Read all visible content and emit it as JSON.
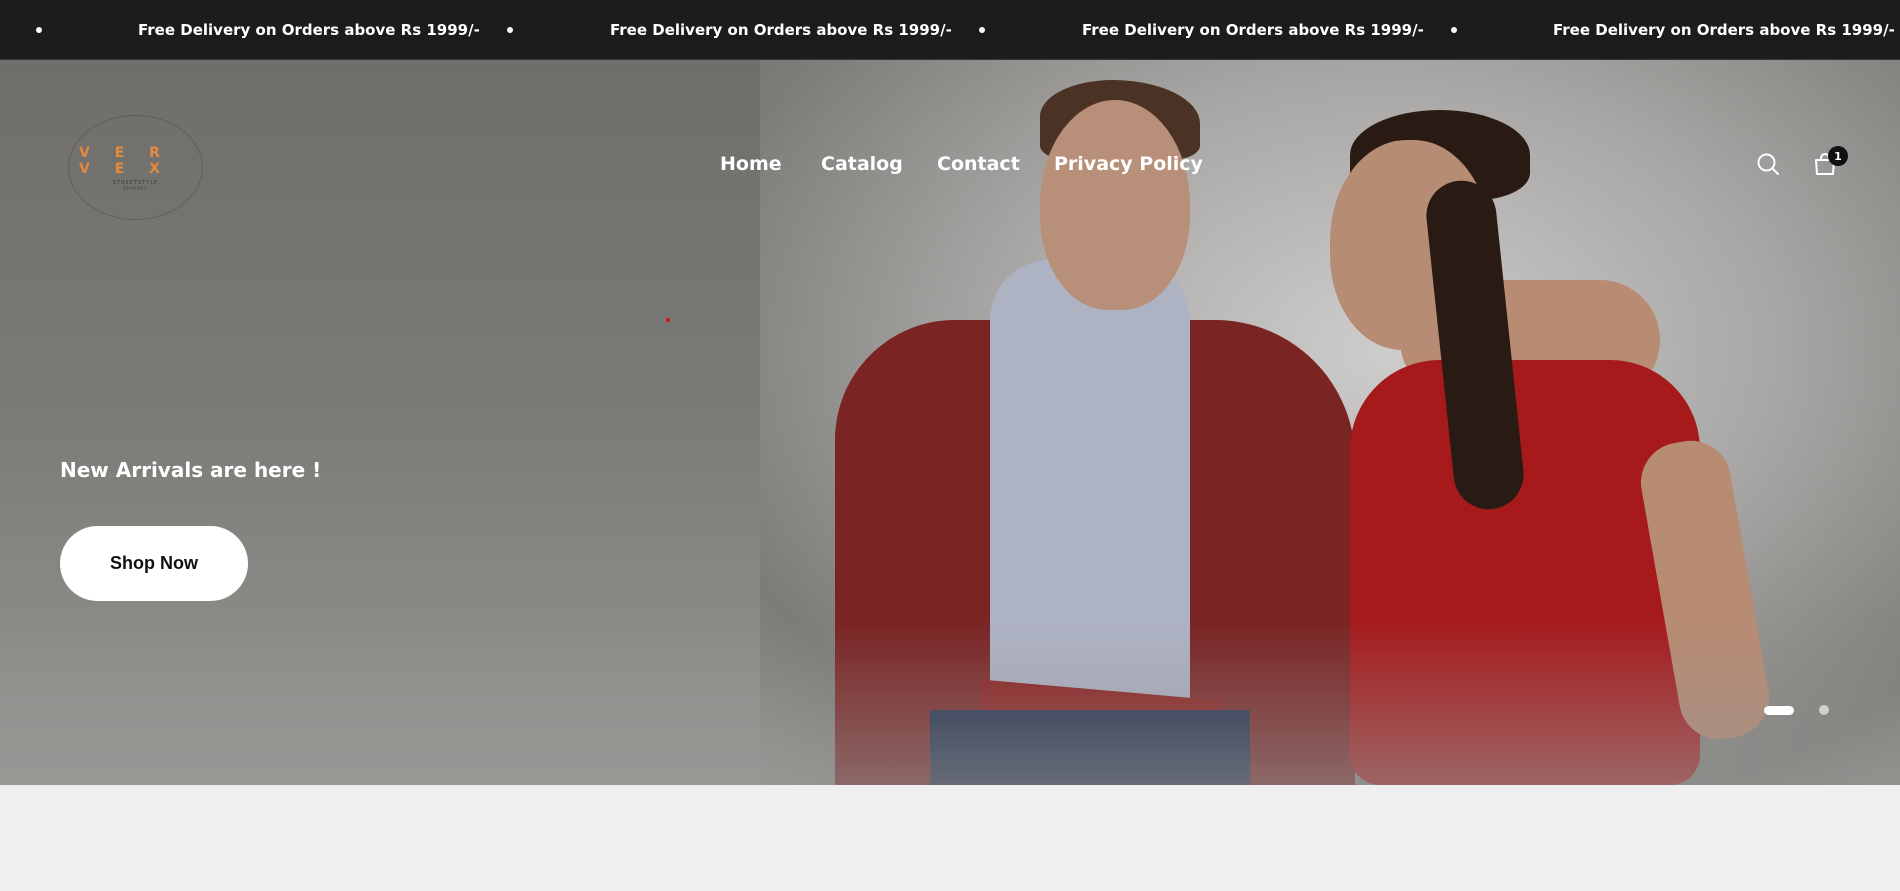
{
  "announcement": {
    "items": [
      "Free Delivery on Orders above Rs 1999/-",
      "Free Delivery on Orders above Rs 1999/-",
      "Free Delivery on Orders above Rs 1999/-",
      "Free Delivery on Orders above Rs 1999/-"
    ]
  },
  "header": {
    "logo": {
      "word": "V E R V E X",
      "tag_line_1": "STREETSTYLE",
      "tag_line_2": "APPAREL"
    },
    "nav": [
      "Home",
      "Catalog",
      "Contact",
      "Privacy Policy"
    ],
    "cart_count": "1",
    "icons": {
      "search": "search-icon",
      "cart": "shopping-bag-icon"
    }
  },
  "hero": {
    "title": "New Arrivals are here !",
    "button_label": "Shop Now",
    "slides": {
      "total": 2,
      "active": 1
    }
  },
  "colors": {
    "announcement_bg": "#1c1c1c",
    "logo_accent": "#e38a3e",
    "page_bg": "#efefef"
  }
}
